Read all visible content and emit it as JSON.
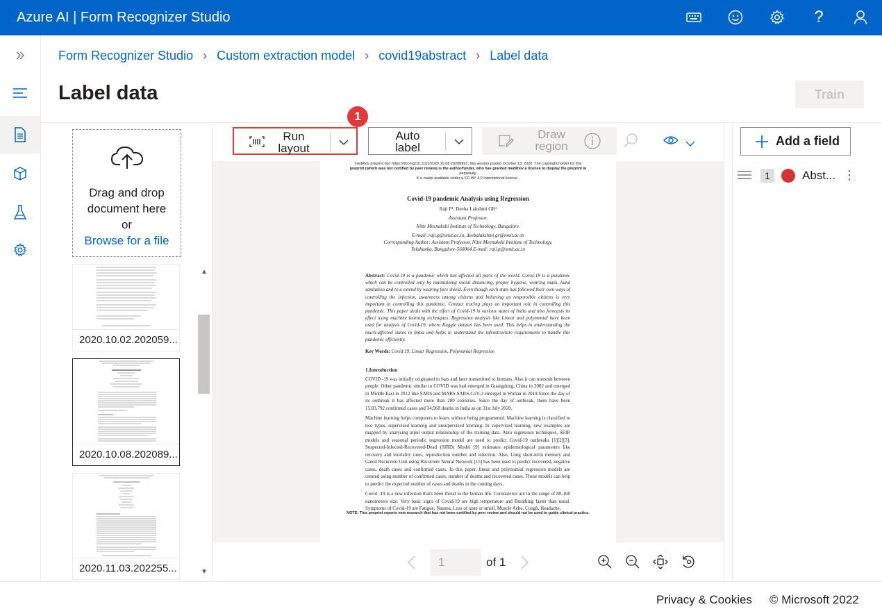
{
  "app": {
    "title": "Azure AI | Form Recognizer Studio"
  },
  "topbar_icons": [
    "keyboard-icon",
    "smiley-icon",
    "settings-icon",
    "help-icon",
    "user-icon"
  ],
  "topbar_help_glyph": "?",
  "breadcrumb": [
    "Form Recognizer Studio",
    "Custom extraction model",
    "covid19abstract",
    "Label data"
  ],
  "page": {
    "title": "Label data",
    "train_label": "Train"
  },
  "upload": {
    "line1": "Drag and drop",
    "line2": "document here",
    "line3": "or",
    "browse": "Browse for a file"
  },
  "files": [
    {
      "name": "2020.10.02.202059...",
      "selected": false
    },
    {
      "name": "2020.10.08.202089...",
      "selected": true
    },
    {
      "name": "2020.11.03.202255...",
      "selected": false
    }
  ],
  "toolbar": {
    "run_layout": "Run layout",
    "auto_label": "Auto label",
    "draw_region": "Draw region",
    "badge": "1"
  },
  "document": {
    "header1": "medRxiv preprint doi: https://doi.org/10.1101/2020.10.08.20208991; this version posted October 13, 2020. The copyright holder for this",
    "header2": "preprint (which was not certified by peer review) is the author/funder, who has granted medRxiv a license to display the preprint in",
    "header3": "perpetuity.",
    "header4": "It is made available under a CC-BY 4.0 International license .",
    "title": "Covid-19 pandemic Analysis using Regression",
    "authors": "Raji P¹, Deeba Lakshmi GR²",
    "role": "Assistant Professor,",
    "institute": "Nitte Meenakshi Institute of Technology, Bangalore.",
    "email": "E-mail: raji.p@nmit.ac.in, deebalakshmi.gr@nmit.ac.in",
    "corr1": "Corresponding Author: Assistant Professor, Nitte Meenakshi Institute of Technology,",
    "corr2": "Yelahanka, Bangalore-560064.E-mail: raji.p@nmit.ac.in",
    "abstract_label": "Abstract:",
    "abstract": "Covid-19 is a pandemic which has affected all parts of the world. Covid-19 is a pandemic which can be controlled only by maintaining social distancing, proper hygiene, wearing mask, hand sanitation and to a extend by wearing face shield. Even though each state has followed their own ways of controlling the infection, awareness among citizens and behaving as responsible citizens is very important in controlling this pandemic. Contact tracing plays an important role in controlling this pandemic. This paper deals with the effect of Covid-19 in various states of India and also forecasts its effect using machine learning techniques. Regression analysis like Linear and polynomial have been used for analysis of Covid-19, where Kaggle dataset has been used. This helps in understanding the much-affected states in India and helps to understand the infrastructure requirements to handle this pandemic efficiently.",
    "keywords_label": "Key Words:",
    "keywords": "Covid 19, Linear Regression, Polynomial Regression",
    "intro_heading": "1.Introduction",
    "intro_p1": "COVID -19 was initially originated in bats and later transmitted to humans. Also it can transmit between people. Other pandemic similar to COVID was had emerged in Guangdong, China in 2002 and emerged in Middle East in 2012 like SARS and MARS.SARS-CoV-2 emerged in Wuhan in 2019.Since the day of its outbreak it has affected more than 200 countries. Since the day of outbreak, there have been 15,83,792 confirmed cases and 34,968 deaths in India as on 31st July 2020.",
    "intro_p2": "Machine learning helps computers to learn, without being programmed. Machine learning is classified to two types, supervised learning and unsupervised learning. In supervised learning, new examples are mapped by analysing input output relationship of the training data. Auto regression techniques, SEIR models and seasonal periodic regression model are used to predict Covid-19 outbreaks [1][2][3]. Suspected-Infected-Recovered-Dead (SIRD) Model [9] estimates epidemiological parameters like recovery and mortality rates, reproduction number and infection. Also, Long short-term memory and Gated Recurrent Unit using Recurrent Neural Network [15] has been used to predict recovered, negative cases, death cases and confirmed cases. In this paper, linear and polynomial regression models are created using number of confirmed cases, number of deaths and recovered cases. These models can help to predict the expected number of cases and deaths in the coming days.",
    "intro_p3": "Covid -19 is a new infection that's been threat to the human life. Coronavirus are in the range of 80-160 nanometers size. Very basic signs of Covid-19 are high temperature and Breathing faster than usual. Symptoms of Covid-19 are Fatigue, Nausea, Loss of taste or smell, Muscle Ache, Cough, Headache,",
    "note": "NOTE: This preprint reports new research that has not been certified by peer review and should not be used to guide clinical practice."
  },
  "pager": {
    "current": "1",
    "of_label": "of 1"
  },
  "fields": {
    "add_label": "Add a field",
    "items": [
      {
        "index": "1",
        "name": "Abst...",
        "color": "#d13438"
      }
    ]
  },
  "footer": {
    "privacy": "Privacy & Cookies",
    "copyright": "© Microsoft 2022"
  },
  "colors": {
    "brand": "#0064c8",
    "highlight": "#e03b3b"
  }
}
